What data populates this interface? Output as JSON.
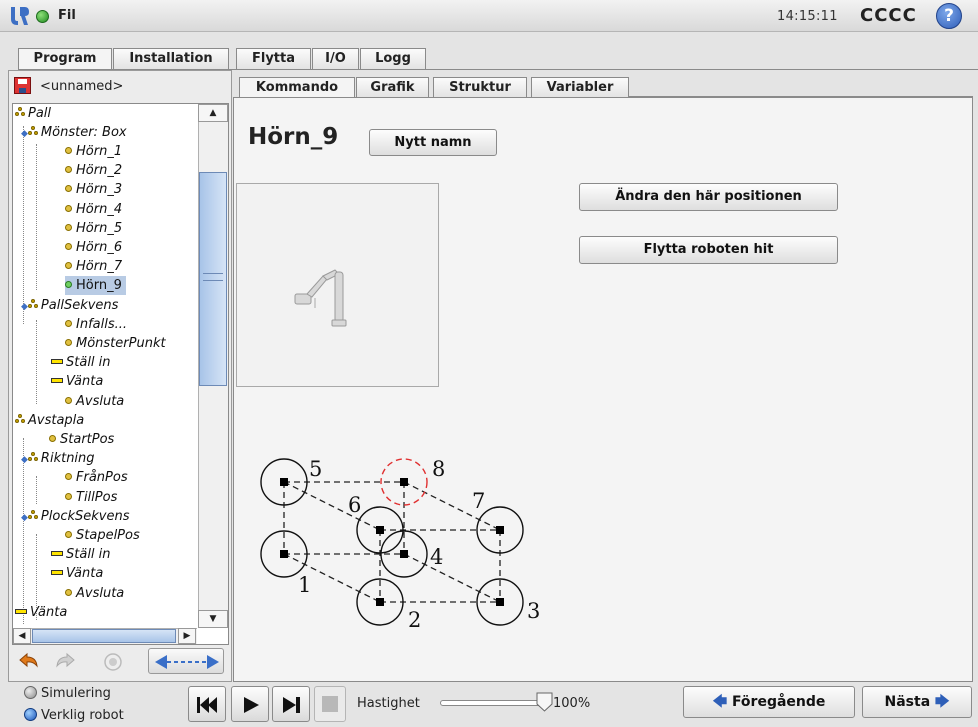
{
  "header": {
    "file_menu": "Fil",
    "clock": "14:15:11",
    "robot_name": "CCCC",
    "help_label": "?"
  },
  "main_tabs": [
    {
      "label": "Program"
    },
    {
      "label": "Installation"
    },
    {
      "label": "Flytta"
    },
    {
      "label": "I/O"
    },
    {
      "label": "Logg"
    }
  ],
  "program": {
    "name": "<unnamed>",
    "tree": [
      {
        "label": "Pall"
      },
      {
        "label": "Mönster: Box"
      },
      {
        "label": "Hörn_1"
      },
      {
        "label": "Hörn_2"
      },
      {
        "label": "Hörn_3"
      },
      {
        "label": "Hörn_4"
      },
      {
        "label": "Hörn_5"
      },
      {
        "label": "Hörn_6"
      },
      {
        "label": "Hörn_7"
      },
      {
        "label": "Hörn_9"
      },
      {
        "label": "PallSekvens"
      },
      {
        "label": "Infalls..."
      },
      {
        "label": "MönsterPunkt"
      },
      {
        "label": "Ställ in"
      },
      {
        "label": "Vänta"
      },
      {
        "label": "Avsluta"
      },
      {
        "label": "Avstapla"
      },
      {
        "label": "StartPos"
      },
      {
        "label": "Riktning"
      },
      {
        "label": "FrånPos"
      },
      {
        "label": "TillPos"
      },
      {
        "label": "PlockSekvens"
      },
      {
        "label": "StapelPos"
      },
      {
        "label": "Ställ in"
      },
      {
        "label": "Vänta"
      },
      {
        "label": "Avsluta"
      },
      {
        "label": "Vänta"
      }
    ]
  },
  "sub_tabs": [
    {
      "label": "Kommando"
    },
    {
      "label": "Grafik"
    },
    {
      "label": "Struktur"
    },
    {
      "label": "Variabler"
    }
  ],
  "command": {
    "waypoint_name": "Hörn_9",
    "rename_button": "Nytt namn",
    "change_position_button": "Ändra den här positionen",
    "move_robot_here_button": "Flytta roboten hit",
    "pattern_labels": [
      "1",
      "2",
      "3",
      "4",
      "5",
      "6",
      "7",
      "8"
    ]
  },
  "footer": {
    "simulation_label": "Simulering",
    "real_robot_label": "Verklig robot",
    "speed_label": "Hastighet",
    "speed_value": "100%",
    "speed_fraction": 1.0,
    "previous_button": "Föregående",
    "next_button": "Nästa"
  },
  "colors": {
    "selected_row": "#b8cbe4",
    "highlight_circle": "#e03030",
    "accent_blue": "#2e5fb8"
  }
}
